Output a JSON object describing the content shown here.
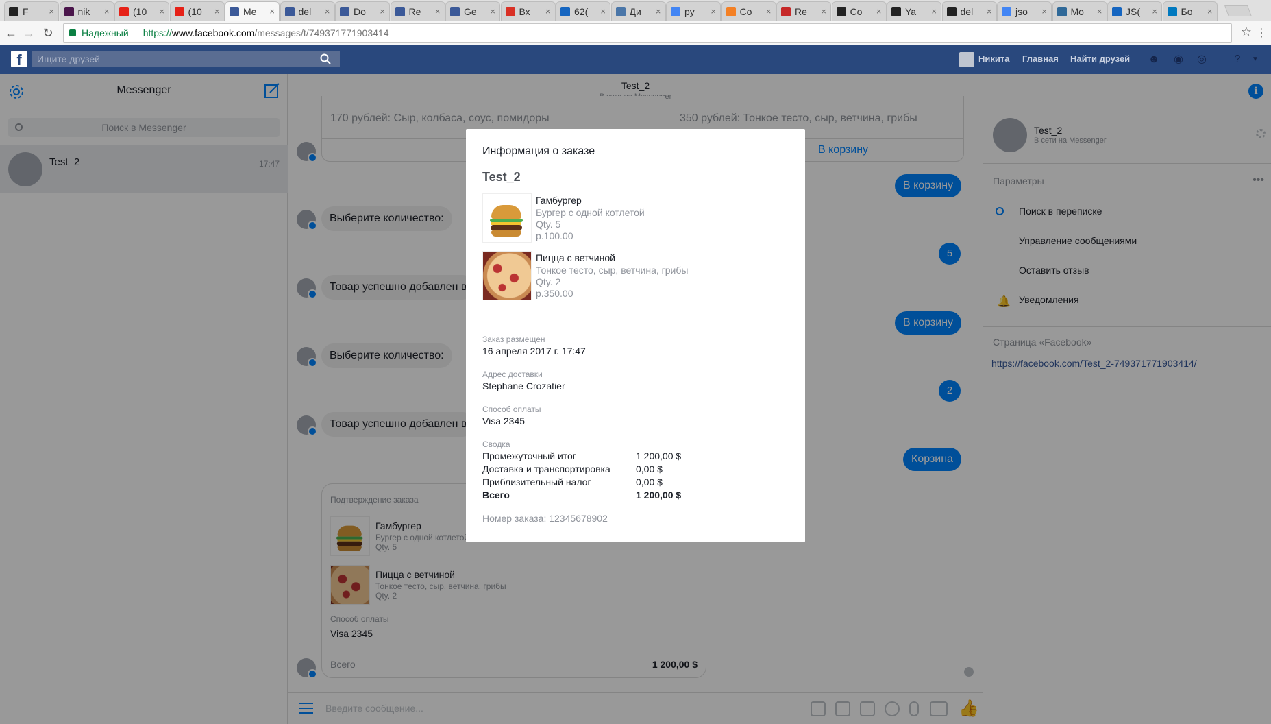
{
  "browser": {
    "tabs": [
      {
        "label": "F",
        "color": "#222"
      },
      {
        "label": "nik",
        "color": "#4a154b"
      },
      {
        "label": "(10",
        "color": "#e62117"
      },
      {
        "label": "(10",
        "color": "#e62117"
      },
      {
        "label": "Me",
        "color": "#3b5998"
      },
      {
        "label": "del",
        "color": "#3b5998"
      },
      {
        "label": "Do",
        "color": "#3b5998"
      },
      {
        "label": "Re",
        "color": "#3b5998"
      },
      {
        "label": "Ge",
        "color": "#3b5998"
      },
      {
        "label": "Вх",
        "color": "#d93025"
      },
      {
        "label": "62(",
        "color": "#1565c0"
      },
      {
        "label": "Ди",
        "color": "#4a76a8"
      },
      {
        "label": "py",
        "color": "#4285f4"
      },
      {
        "label": "Co",
        "color": "#f48024"
      },
      {
        "label": "Re",
        "color": "#c62828"
      },
      {
        "label": "Co",
        "color": "#222"
      },
      {
        "label": "Ya",
        "color": "#222"
      },
      {
        "label": "del",
        "color": "#222"
      },
      {
        "label": "jso",
        "color": "#4285f4"
      },
      {
        "label": "Mo",
        "color": "#306998"
      },
      {
        "label": "JS(",
        "color": "#1565c0"
      },
      {
        "label": "Бо",
        "color": "#0079bf"
      }
    ],
    "secure_label": "Надежный",
    "url_scheme": "https://",
    "url_host": "www.facebook.com",
    "url_path": "/messages/t/749371771903414"
  },
  "fb": {
    "search_placeholder": "Ищите друзей",
    "user_name": "Никита",
    "nav_home": "Главная",
    "nav_find": "Найти друзей"
  },
  "messenger": {
    "title": "Messenger",
    "search_placeholder": "Поиск в Messenger",
    "conversation": {
      "name": "Test_2",
      "time": "17:47"
    },
    "chat_name": "Test_2",
    "chat_status": "В сети на Messenger"
  },
  "chat": {
    "card1_text": "170 рублей: Сыр, колбаса, соус, помидоры",
    "card2_text": "350 рублей: Тонкое тесто, сыр, ветчина, грибы",
    "add_to_cart_link": "В корзину",
    "msg_choose_qty_1": "Выберите количество:",
    "msg_added_1": "Товар успешно добавлен в",
    "msg_choose_qty_2": "Выберите количество:",
    "msg_added_2": "Товар успешно добавлен в",
    "out_add_1": "В корзину",
    "out_qty_1": "5",
    "out_add_2": "В корзину",
    "out_qty_2": "2",
    "out_cart": "Корзина",
    "receipt": {
      "header": "Подтверждение заказа",
      "items": [
        {
          "name": "Гамбургер",
          "desc": "Бургер с одной котлетой",
          "qty": "Qty. 5"
        },
        {
          "name": "Пицца с ветчиной",
          "desc": "Тонкое тесто, сыр, ветчина, грибы",
          "qty": "Qty. 2"
        }
      ],
      "payment_label": "Способ оплаты",
      "payment_value": "Visa 2345",
      "total_label": "Всего",
      "total_value": "1 200,00 $"
    },
    "composer_placeholder": "Введите сообщение..."
  },
  "details": {
    "name": "Test_2",
    "status": "В сети на Messenger",
    "options_label": "Параметры",
    "rows": [
      "Поиск в переписке",
      "Управление сообщениями",
      "Оставить отзыв",
      "Уведомления"
    ],
    "page_label": "Страница «Facebook»",
    "page_link": "https://facebook.com/Test_2-749371771903414/"
  },
  "modal": {
    "title": "Информация о заказе",
    "recipient": "Test_2",
    "items": [
      {
        "name": "Гамбургер",
        "desc": "Бургер с одной котлетой",
        "qty": "Qty. 5",
        "price": "р.100.00"
      },
      {
        "name": "Пицца с ветчиной",
        "desc": "Тонкое тесто, сыр, ветчина, грибы",
        "qty": "Qty. 2",
        "price": "р.350.00"
      }
    ],
    "placed_label": "Заказ размещен",
    "placed_value": "16 апреля 2017 г. 17:47",
    "address_label": "Адрес доставки",
    "address_value": "Stephane Crozatier",
    "payment_label": "Способ оплаты",
    "payment_value": "Visa 2345",
    "summary_label": "Сводка",
    "summary": [
      {
        "k": "Промежуточный итог",
        "v": "1 200,00 $"
      },
      {
        "k": "Доставка и транспортировка",
        "v": "0,00 $"
      },
      {
        "k": "Приблизительный налог",
        "v": "0,00 $"
      },
      {
        "k": "Всего",
        "v": "1 200,00 $"
      }
    ],
    "order_number": "Номер заказа: 12345678902"
  },
  "colors": {
    "fb_blue": "#29487d",
    "messenger_blue": "#0084ff"
  }
}
